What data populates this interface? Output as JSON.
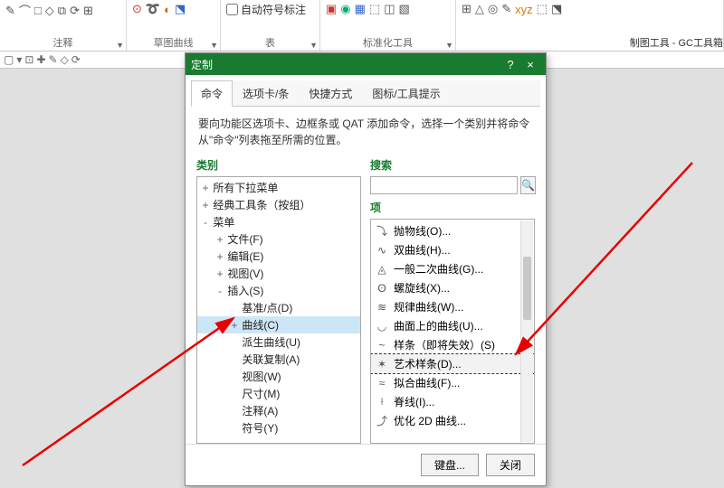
{
  "ribbon": {
    "groups": [
      {
        "label": "注释"
      },
      {
        "label": "草图曲线"
      },
      {
        "label": "表"
      },
      {
        "label": "标准化工具"
      }
    ],
    "autolabel": "自动符号标注",
    "boxlabel": "制图工具 - GC工具箱"
  },
  "dialog": {
    "title": "定制",
    "help": "?",
    "close": "×",
    "tabs": [
      "命令",
      "选项卡/条",
      "快捷方式",
      "图标/工具提示"
    ],
    "desc": "要向功能区选项卡、边框条或 QAT 添加命令，选择一个类别并将命令从\"命令\"列表拖至所需的位置。",
    "category_label": "类别",
    "search_label": "搜索",
    "items_label": "项",
    "tree": [
      {
        "d": 0,
        "tg": "+",
        "t": "所有下拉菜单"
      },
      {
        "d": 0,
        "tg": "+",
        "t": "经典工具条（按组）"
      },
      {
        "d": 0,
        "tg": "-",
        "t": "菜单"
      },
      {
        "d": 1,
        "tg": "+",
        "t": "文件(F)"
      },
      {
        "d": 1,
        "tg": "+",
        "t": "编辑(E)"
      },
      {
        "d": 1,
        "tg": "+",
        "t": "视图(V)"
      },
      {
        "d": 1,
        "tg": "-",
        "t": "插入(S)"
      },
      {
        "d": 2,
        "tg": "",
        "t": "基准/点(D)"
      },
      {
        "d": 2,
        "tg": "+",
        "t": "曲线(C)",
        "sel": true
      },
      {
        "d": 2,
        "tg": "",
        "t": "派生曲线(U)"
      },
      {
        "d": 2,
        "tg": "",
        "t": "关联复制(A)"
      },
      {
        "d": 2,
        "tg": "",
        "t": "视图(W)"
      },
      {
        "d": 2,
        "tg": "",
        "t": "尺寸(M)"
      },
      {
        "d": 2,
        "tg": "",
        "t": "注释(A)"
      },
      {
        "d": 2,
        "tg": "",
        "t": "符号(Y)"
      }
    ],
    "items": [
      {
        "ic": "⤵",
        "t": "抛物线(O)..."
      },
      {
        "ic": "∿",
        "t": "双曲线(H)..."
      },
      {
        "ic": "◬",
        "t": "一般二次曲线(G)..."
      },
      {
        "ic": "ʘ",
        "t": "螺旋线(X)..."
      },
      {
        "ic": "≋",
        "t": "规律曲线(W)..."
      },
      {
        "ic": "◡",
        "t": "曲面上的曲线(U)..."
      },
      {
        "ic": "~",
        "t": "样条（即将失效）(S)"
      },
      {
        "ic": "✶",
        "t": "艺术样条(D)...",
        "sel": true
      },
      {
        "ic": "≈",
        "t": "拟合曲线(F)..."
      },
      {
        "ic": "⟊",
        "t": "脊线(I)..."
      },
      {
        "ic": "⤴",
        "t": "优化 2D 曲线..."
      }
    ],
    "buttons": {
      "kb": "键盘...",
      "close": "关闭"
    }
  }
}
